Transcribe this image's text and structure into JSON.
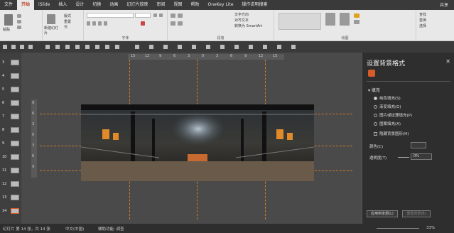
{
  "tabs": [
    {
      "label": "文件",
      "active": false
    },
    {
      "label": "开始",
      "active": true
    },
    {
      "label": "iSlide",
      "active": false
    },
    {
      "label": "插入",
      "active": false
    },
    {
      "label": "设计",
      "active": false
    },
    {
      "label": "切换",
      "active": false
    },
    {
      "label": "动画",
      "active": false
    },
    {
      "label": "幻灯片放映",
      "active": false
    },
    {
      "label": "审阅",
      "active": false
    },
    {
      "label": "视图",
      "active": false
    },
    {
      "label": "帮助",
      "active": false
    },
    {
      "label": "OneKey Lite",
      "active": false
    }
  ],
  "tell_me": "操作说明搜索",
  "share_label": "共享",
  "ribbon": {
    "paste": "粘贴",
    "new_slide": "新建幻灯片",
    "layout": "版式",
    "reset": "重置",
    "section": "节",
    "font_group": "字体",
    "paragraph_group": "段落",
    "text_direction": "文字方向",
    "align_text": "对齐文本",
    "smartart": "转换为 SmartArt",
    "drawing_group": "绘图",
    "find": "查找",
    "replace": "替换",
    "select": "选择"
  },
  "ruler_ticks": [
    "15",
    "12",
    "9",
    "6",
    "3",
    "0",
    "3",
    "6",
    "9",
    "12",
    "15"
  ],
  "vruler_ticks": [
    "9",
    "6",
    "3",
    "0",
    "3",
    "6",
    "9"
  ],
  "thumbnails": [
    {
      "n": "3"
    },
    {
      "n": "4"
    },
    {
      "n": "5"
    },
    {
      "n": "6"
    },
    {
      "n": "7"
    },
    {
      "n": "8"
    },
    {
      "n": "9"
    },
    {
      "n": "10"
    },
    {
      "n": "11"
    },
    {
      "n": "12"
    },
    {
      "n": "13"
    },
    {
      "n": "14"
    }
  ],
  "pane": {
    "title": "设置背景格式",
    "close": "✕",
    "section": "填充",
    "options": [
      {
        "label": "纯色填充(S)",
        "selected": true
      },
      {
        "label": "渐变填充(G)",
        "selected": false
      },
      {
        "label": "图片或纹理填充(P)",
        "selected": false
      },
      {
        "label": "图案填充(A)",
        "selected": false
      }
    ],
    "hide_bg": "隐藏背景图形(H)",
    "color_label": "颜色(C)",
    "transparency_label": "透明度(T)",
    "transparency_value": "0%",
    "apply_all": "应用到全部(L)",
    "reset_bg": "重置背景(B)"
  },
  "status": {
    "slide": "幻灯片 第 14 张，共 14 张",
    "lang": "中文(中国)",
    "access": "辅助功能: 调查",
    "zoom": "33%"
  },
  "colors": {
    "accent": "#b7472a",
    "guide": "#d07a2a"
  }
}
